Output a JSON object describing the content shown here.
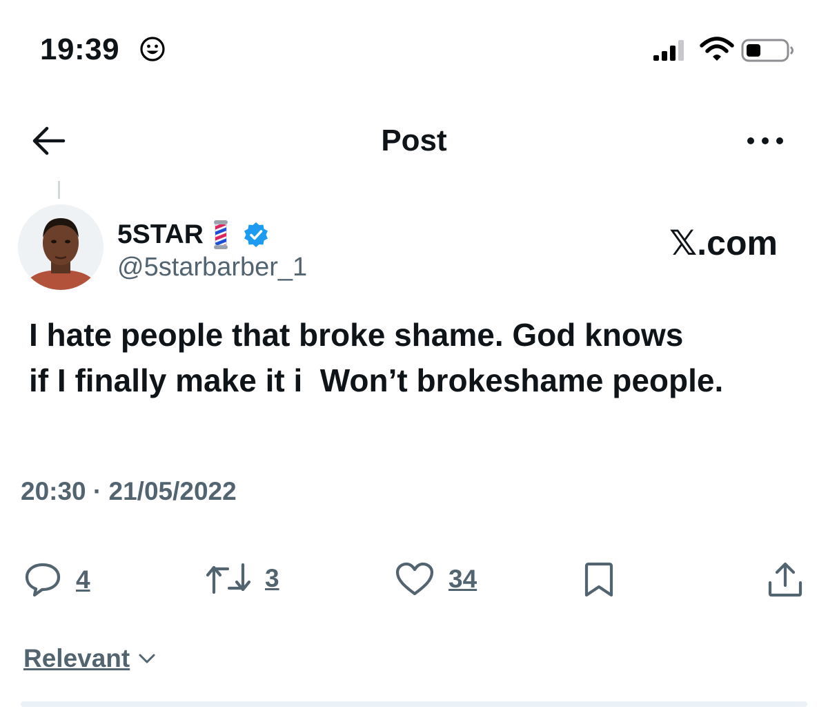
{
  "status_bar": {
    "time": "19:39",
    "smiley_icon": "smiley-face-icon",
    "signal_icon": "cellular-signal-icon",
    "wifi_icon": "wifi-icon",
    "battery_icon": "battery-icon"
  },
  "nav": {
    "back_icon": "arrow-left-icon",
    "title": "Post",
    "more_icon": "more-horizontal-icon"
  },
  "author": {
    "display_name": "5STAR",
    "emoji": "barber-pole-icon",
    "verified_icon": "verified-badge-icon",
    "handle": "@5starbarber_1"
  },
  "watermark": "𝕏.com",
  "post": {
    "lines": [
      "I hate people that broke shame. God knows",
      "if I finally make it i  Won’t brokeshame people."
    ],
    "timestamp": "20:30 · 21/05/2022"
  },
  "actions": {
    "replies": "4",
    "reposts": "3",
    "likes": "34",
    "bookmark_icon": "bookmark-icon",
    "share_icon": "share-icon"
  },
  "sort": {
    "label": "Relevant",
    "icon": "chevron-down-icon"
  },
  "colors": {
    "text": "#0f1419",
    "secondary": "#536471",
    "verified": "#1d9bf0"
  }
}
